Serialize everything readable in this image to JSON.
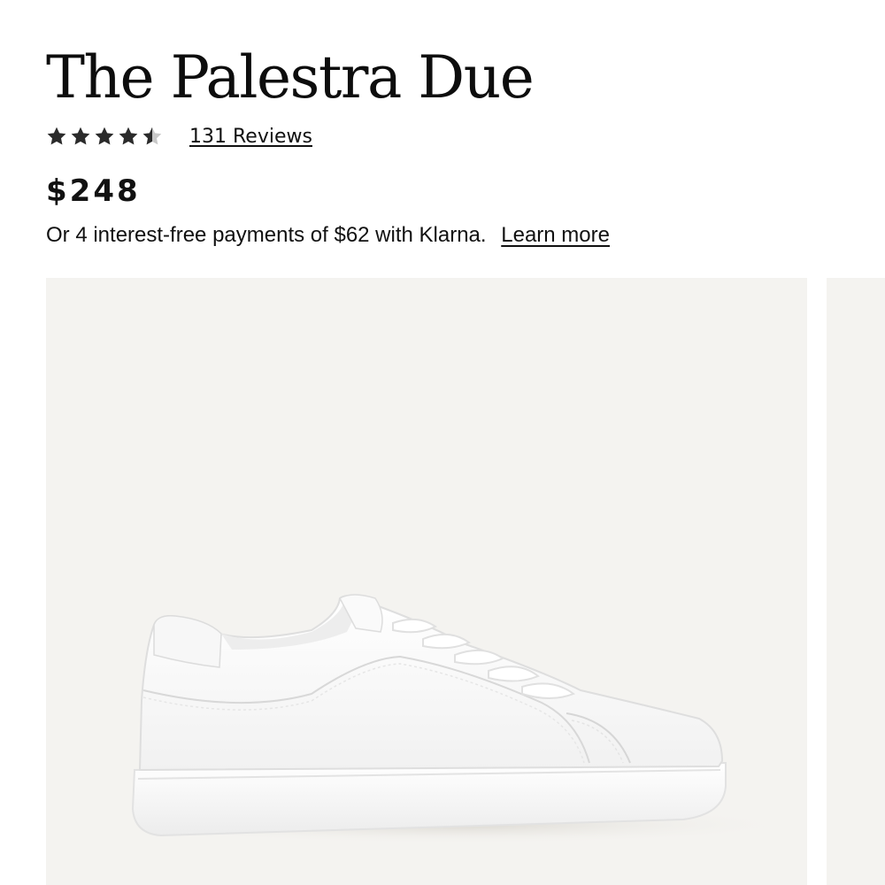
{
  "product": {
    "title": "The Palestra Due",
    "rating": 4.5,
    "rating_max": 5,
    "reviews_label": "131 Reviews",
    "price": "$248",
    "klarna_text": "Or 4 interest-free payments of $62 with Klarna.",
    "learn_more_label": "Learn more"
  },
  "gallery": {
    "main_image_icon": "white-sneaker-image",
    "background_color": "#f4f3f0"
  },
  "colors": {
    "text": "#111111",
    "star_filled": "#2b2b2b",
    "star_empty": "#c8c8c8"
  }
}
